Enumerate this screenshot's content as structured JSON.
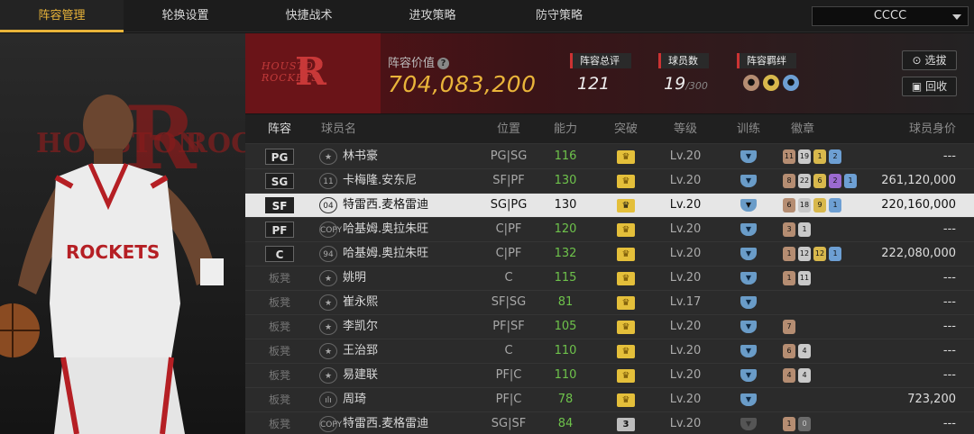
{
  "nav": {
    "tabs": [
      "阵容管理",
      "轮换设置",
      "快捷战术",
      "进攻策略",
      "防守策略"
    ],
    "active_tab": 0,
    "team_select": "CCCC"
  },
  "poster": {
    "bg_text": "HOUSTON",
    "bg_text2": "ROCK",
    "jersey": "ROCKETS"
  },
  "header": {
    "logo_text": "HOUSTON ROCKETS",
    "value_label": "阵容价值",
    "value": "704,083,200",
    "overall_label": "阵容总评",
    "overall_value": "121",
    "players_label": "球员数",
    "players_value": "19",
    "players_max": "/300",
    "chem_label": "阵容羁绊",
    "select_button": "选拔",
    "recycle_button": "回收"
  },
  "table": {
    "columns": [
      "阵容",
      "球员名",
      "位置",
      "能力",
      "突破",
      "等级",
      "训练",
      "徽章",
      "球员身价"
    ],
    "rows": [
      {
        "slot": "PG",
        "num": "★",
        "name": "林书豪",
        "position": "PG|SG",
        "ability": "116",
        "break": "crown",
        "level": "Lv.20",
        "badges": [
          [
            "11",
            "bronze"
          ],
          [
            "19",
            "silver"
          ],
          [
            "1",
            "gold"
          ],
          [
            "2",
            "blue"
          ]
        ],
        "worth": "---"
      },
      {
        "slot": "SG",
        "num": "11",
        "name": "卡梅隆.安东尼",
        "position": "SF|PF",
        "ability": "130",
        "break": "crown",
        "level": "Lv.20",
        "badges": [
          [
            "8",
            "bronze"
          ],
          [
            "22",
            "silver"
          ],
          [
            "6",
            "gold"
          ],
          [
            "2",
            "purple"
          ],
          [
            "1",
            "blue"
          ]
        ],
        "worth": "261,120,000"
      },
      {
        "slot": "SF",
        "num": "04",
        "name": "特雷西.麦格雷迪",
        "position": "SG|PG",
        "ability": "130",
        "break": "crown",
        "level": "Lv.20",
        "badges": [
          [
            "6",
            "bronze"
          ],
          [
            "18",
            "silver"
          ],
          [
            "9",
            "gold"
          ],
          [
            "1",
            "blue"
          ]
        ],
        "worth": "220,160,000"
      },
      {
        "slot": "PF",
        "num": "COPY",
        "name": "哈基姆.奥拉朱旺",
        "position": "C|PF",
        "ability": "120",
        "break": "crown",
        "level": "Lv.20",
        "badges": [
          [
            "3",
            "bronze"
          ],
          [
            "1",
            "silver"
          ]
        ],
        "worth": "---"
      },
      {
        "slot": "C",
        "num": "94",
        "name": "哈基姆.奥拉朱旺",
        "position": "C|PF",
        "ability": "132",
        "break": "crown",
        "level": "Lv.20",
        "badges": [
          [
            "1",
            "bronze"
          ],
          [
            "12",
            "silver"
          ],
          [
            "12",
            "gold"
          ],
          [
            "1",
            "blue"
          ]
        ],
        "worth": "222,080,000"
      },
      {
        "slot": "板凳",
        "num": "★",
        "name": "姚明",
        "position": "C",
        "ability": "115",
        "break": "crown",
        "level": "Lv.20",
        "badges": [
          [
            "1",
            "bronze"
          ],
          [
            "11",
            "silver"
          ]
        ],
        "worth": "---"
      },
      {
        "slot": "板凳",
        "num": "★",
        "name": "崔永熙",
        "position": "SF|SG",
        "ability": "81",
        "break": "crown",
        "level": "Lv.17",
        "badges": [],
        "worth": "---"
      },
      {
        "slot": "板凳",
        "num": "★",
        "name": "李凯尔",
        "position": "PF|SF",
        "ability": "105",
        "break": "crown",
        "level": "Lv.20",
        "badges": [
          [
            "7",
            "bronze"
          ]
        ],
        "worth": "---"
      },
      {
        "slot": "板凳",
        "num": "★",
        "name": "王治郅",
        "position": "C",
        "ability": "110",
        "break": "crown",
        "level": "Lv.20",
        "badges": [
          [
            "6",
            "bronze"
          ],
          [
            "4",
            "silver"
          ]
        ],
        "worth": "---"
      },
      {
        "slot": "板凳",
        "num": "★",
        "name": "易建联",
        "position": "PF|C",
        "ability": "110",
        "break": "crown",
        "level": "Lv.20",
        "badges": [
          [
            "4",
            "bronze"
          ],
          [
            "4",
            "silver"
          ]
        ],
        "worth": "---"
      },
      {
        "slot": "板凳",
        "num": "ılı",
        "name": "周琦",
        "position": "PF|C",
        "ability": "78",
        "break": "crown",
        "level": "Lv.20",
        "badges": [],
        "worth": "723,200"
      },
      {
        "slot": "板凳",
        "num": "COPY",
        "name": "特雷西.麦格雷迪",
        "position": "SG|SF",
        "ability": "84",
        "break": "3",
        "level": "Lv.20",
        "badges": [
          [
            "1",
            "bronze"
          ],
          [
            "0",
            "dark"
          ]
        ],
        "worth": "---"
      }
    ],
    "selected_row": 2
  },
  "colors": {
    "accent": "#e9b43a",
    "ability_green": "#6ec24b",
    "header_red": "#5a1116"
  }
}
